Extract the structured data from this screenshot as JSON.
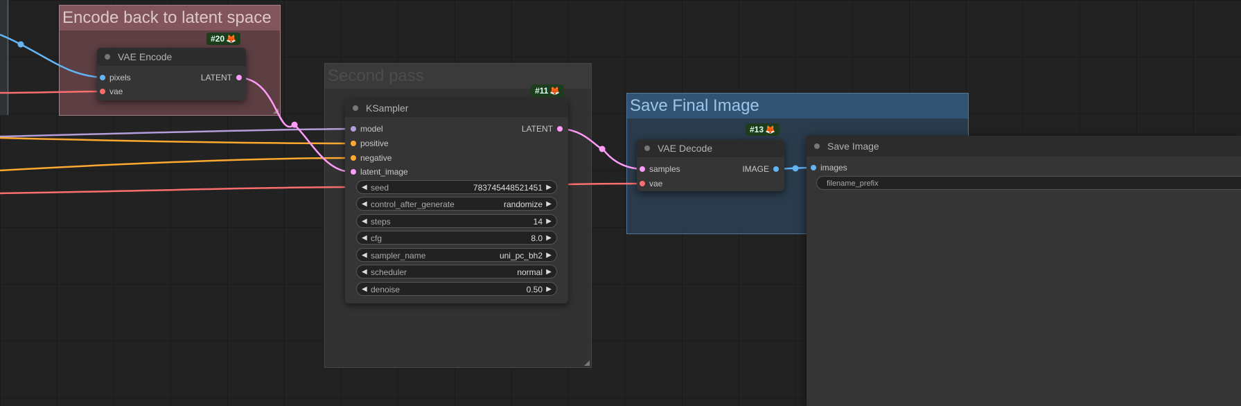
{
  "groups": {
    "encode": "Encode back to latent space",
    "second": "Second pass",
    "save": "Save Final Image"
  },
  "vae_encode": {
    "badge": "#20",
    "title": "VAE Encode",
    "inputs": [
      "pixels",
      "vae"
    ],
    "output": "LATENT"
  },
  "ksampler": {
    "badge": "#11",
    "title": "KSampler",
    "inputs": [
      "model",
      "positive",
      "negative",
      "latent_image"
    ],
    "output": "LATENT",
    "widgets": [
      {
        "label": "seed",
        "value": "783745448521451"
      },
      {
        "label": "control_after_generate",
        "value": "randomize"
      },
      {
        "label": "steps",
        "value": "14"
      },
      {
        "label": "cfg",
        "value": "8.0"
      },
      {
        "label": "sampler_name",
        "value": "uni_pc_bh2"
      },
      {
        "label": "scheduler",
        "value": "normal"
      },
      {
        "label": "denoise",
        "value": "0.50"
      }
    ]
  },
  "vae_decode": {
    "badge": "#13",
    "title": "VAE Decode",
    "inputs": [
      "samples",
      "vae"
    ],
    "output": "IMAGE"
  },
  "save_image": {
    "title": "Save Image",
    "input": "images",
    "widget": "filename_prefix"
  },
  "colors": {
    "model": "#b39ddb",
    "conditioning": "#ffa931",
    "latent": "#ff9cf9",
    "vae": "#ff6e6e",
    "image": "#64b5f6"
  }
}
